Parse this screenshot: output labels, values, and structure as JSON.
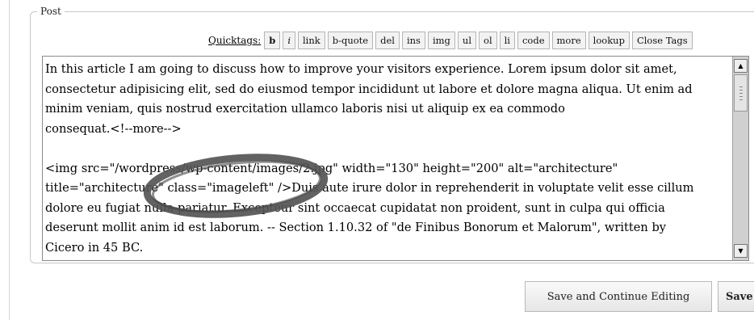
{
  "fieldset": {
    "legend": "Post"
  },
  "quicktags": {
    "label": "Quicktags:",
    "buttons": [
      "b",
      "i",
      "link",
      "b-quote",
      "del",
      "ins",
      "img",
      "ul",
      "ol",
      "li",
      "code",
      "more",
      "lookup",
      "Close Tags"
    ]
  },
  "editor": {
    "lines": [
      "In this article I am going to discuss how to improve your visitors experience. Lorem ipsum dolor sit amet,",
      "consectetur adipisicing elit, sed do eiusmod tempor incididunt ut labore et dolore magna aliqua. Ut enim ad",
      "minim veniam, quis nostrud exercitation ullamco laboris nisi ut aliquip ex ea commodo",
      "consequat.<!--more-->",
      "",
      "<img src=\"/wordpress/wp-content/images/2.jpg\" width=\"130\" height=\"200\" alt=\"architecture\"",
      "title=\"architecture\" class=\"imageleft\" />Duis aute irure dolor in reprehenderit in voluptate velit esse cillum",
      "dolore eu fugiat nulla pariatur. Excepteur sint occaecat cupidatat non proident, sunt in culpa qui officia",
      "deserunt mollit anim id est laborum. -- Section 1.10.32 of \"de Finibus Bonorum et Malorum\", written by",
      "Cicero in 45 BC."
    ]
  },
  "actions": {
    "save_continue": "Save and Continue Editing",
    "save": "Save"
  },
  "colors": {
    "annotation_stroke": "#555555",
    "button_border": "#b5b5b5",
    "scrollbar_track": "#d0d0d0"
  }
}
